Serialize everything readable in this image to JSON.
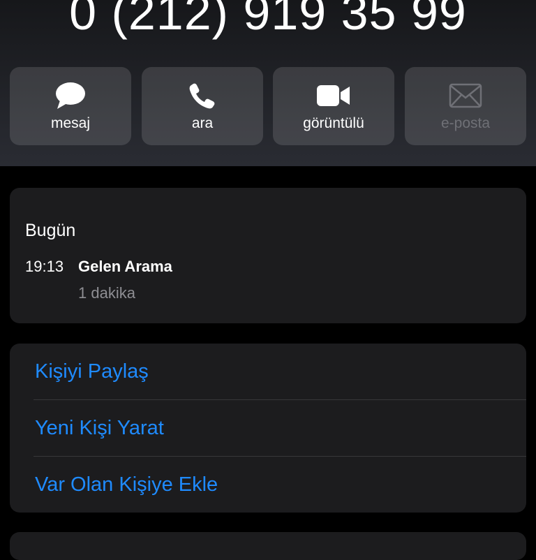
{
  "contact": {
    "phone_number": "0 (212) 919 35 99"
  },
  "actions": [
    {
      "label": "mesaj",
      "icon": "message-bubble-icon",
      "enabled": true
    },
    {
      "label": "ara",
      "icon": "phone-icon",
      "enabled": true
    },
    {
      "label": "görüntülü",
      "icon": "video-camera-icon",
      "enabled": true
    },
    {
      "label": "e-posta",
      "icon": "envelope-icon",
      "enabled": false
    }
  ],
  "call_history": {
    "date": "Bugün",
    "entries": [
      {
        "time": "19:13",
        "type": "Gelen Arama",
        "duration": "1 dakika"
      }
    ]
  },
  "options": [
    {
      "label": "Kişiyi Paylaş"
    },
    {
      "label": "Yeni Kişi Yarat"
    },
    {
      "label": "Var Olan Kişiye Ekle"
    }
  ],
  "colors": {
    "accent": "#1f8bff",
    "background": "#000000",
    "card": "#1c1c1e",
    "secondary_text": "#8e8e93",
    "disabled_text": "#6f7076"
  }
}
